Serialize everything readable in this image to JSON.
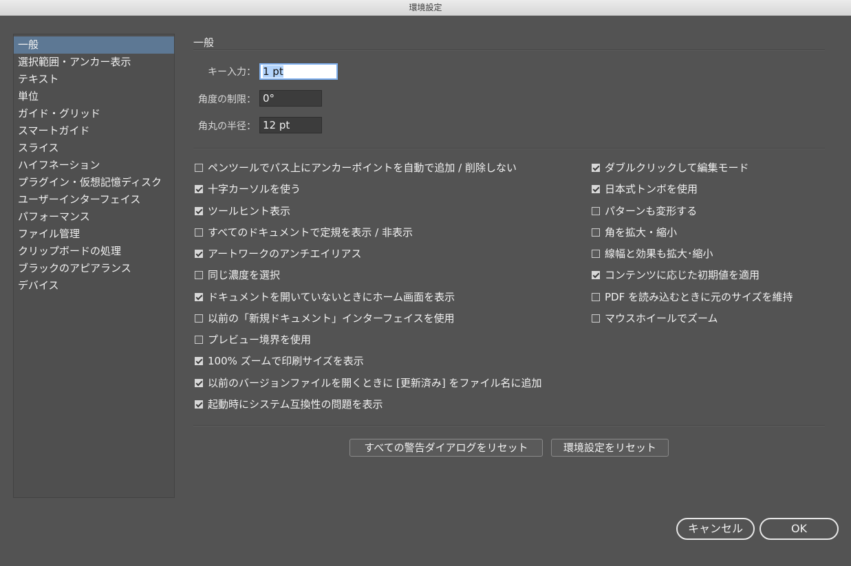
{
  "window": {
    "title": "環境設定"
  },
  "sidebar": {
    "items": [
      {
        "label": "一般",
        "selected": true
      },
      {
        "label": "選択範囲・アンカー表示"
      },
      {
        "label": "テキスト"
      },
      {
        "label": "単位"
      },
      {
        "label": "ガイド・グリッド"
      },
      {
        "label": "スマートガイド"
      },
      {
        "label": "スライス"
      },
      {
        "label": "ハイフネーション"
      },
      {
        "label": "プラグイン・仮想記憶ディスク"
      },
      {
        "label": "ユーザーインターフェイス"
      },
      {
        "label": "パフォーマンス"
      },
      {
        "label": "ファイル管理"
      },
      {
        "label": "クリップボードの処理"
      },
      {
        "label": "ブラックのアピアランス"
      },
      {
        "label": "デバイス"
      }
    ]
  },
  "main": {
    "section_title": "一般",
    "fields": {
      "key_input": {
        "label": "キー入力：",
        "value": "1 pt"
      },
      "angle_limit": {
        "label": "角度の制限：",
        "value": "0°"
      },
      "corner_radius": {
        "label": "角丸の半径：",
        "value": "12 pt"
      }
    },
    "left_options": [
      {
        "label": "ペンツールでパス上にアンカーポイントを自動で追加 / 削除しない",
        "checked": false
      },
      {
        "label": "十字カーソルを使う",
        "checked": true
      },
      {
        "label": "ツールヒント表示",
        "checked": true
      },
      {
        "label": "すべてのドキュメントで定規を表示 / 非表示",
        "checked": false
      },
      {
        "label": "アートワークのアンチエイリアス",
        "checked": true
      },
      {
        "label": "同じ濃度を選択",
        "checked": false
      },
      {
        "label": "ドキュメントを開いていないときにホーム画面を表示",
        "checked": true
      },
      {
        "label": "以前の「新規ドキュメント」インターフェイスを使用",
        "checked": false
      },
      {
        "label": "プレビュー境界を使用",
        "checked": false
      },
      {
        "label": "100% ズームで印刷サイズを表示",
        "checked": true
      },
      {
        "label": "以前のバージョンファイルを開くときに [更新済み] をファイル名に追加",
        "checked": true
      },
      {
        "label": "起動時にシステム互換性の問題を表示",
        "checked": true
      }
    ],
    "right_options": [
      {
        "label": "ダブルクリックして編集モード",
        "checked": true
      },
      {
        "label": "日本式トンボを使用",
        "checked": true
      },
      {
        "label": "パターンも変形する",
        "checked": false
      },
      {
        "label": "角を拡大・縮小",
        "checked": false
      },
      {
        "label": "線幅と効果も拡大･縮小",
        "checked": false
      },
      {
        "label": "コンテンツに応じた初期値を適用",
        "checked": true
      },
      {
        "label": "PDF を読み込むときに元のサイズを維持",
        "checked": false
      },
      {
        "label": "マウスホイールでズーム",
        "checked": false
      }
    ],
    "reset_warnings_label": "すべての警告ダイアログをリセット",
    "reset_prefs_label": "環境設定をリセット"
  },
  "footer": {
    "cancel_label": "キャンセル",
    "ok_label": "OK"
  }
}
